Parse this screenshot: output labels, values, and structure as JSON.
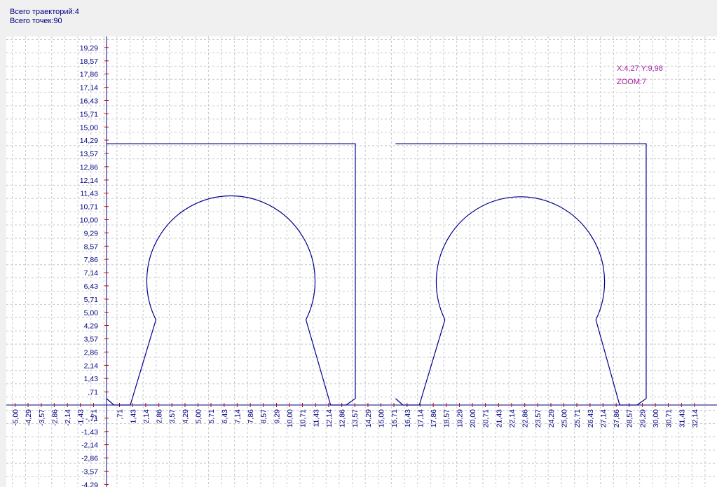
{
  "info": {
    "total_paths": "Всего траекторий:4",
    "total_points": "Всего точек:90"
  },
  "readout": {
    "coords": "X:4,27 Y:9,98",
    "zoom": "ZOOM:7"
  },
  "colors": {
    "background": "#ffffff",
    "grid": "#c8c8c8",
    "axis": "#000080",
    "path": "#00008b",
    "tick_text": "#000080",
    "readout_text": "#a020a0",
    "tick_marks": "#cc0000"
  },
  "chart_data": {
    "type": "line",
    "grid": true,
    "xlim": [
      -5.4,
      32.6
    ],
    "ylim": [
      -4.4,
      19.7
    ],
    "x_ticks": [
      "-5,00",
      "-4,29",
      "-3,57",
      "-2,86",
      "-2,14",
      "-1,43",
      "-,71",
      ",71",
      "1,43",
      "2,14",
      "2,86",
      "3,57",
      "4,29",
      "5,00",
      "5,71",
      "6,43",
      "7,14",
      "7,86",
      "8,57",
      "9,29",
      "10,00",
      "10,71",
      "11,43",
      "12,14",
      "12,86",
      "13,57",
      "14,29",
      "15,00",
      "15,71",
      "16,43",
      "17,14",
      "17,86",
      "18,57",
      "19,29",
      "20,00",
      "20,71",
      "21,43",
      "22,14",
      "22,86",
      "23,57",
      "24,29",
      "25,00",
      "25,71",
      "26,43",
      "27,14",
      "27,86",
      "28,57",
      "29,29",
      "30,00",
      "30,71",
      "31,43",
      "32,14"
    ],
    "y_ticks": [
      "19,29",
      "18,57",
      "17,86",
      "17,14",
      "16,43",
      "15,71",
      "15,00",
      "14,29",
      "13,57",
      "12,86",
      "12,14",
      "11,43",
      "10,71",
      "10,00",
      "9,29",
      "8,57",
      "7,86",
      "7,14",
      "6,43",
      "5,71",
      "5,00",
      "4,29",
      "3,57",
      "2,86",
      "2,14",
      "1,43",
      ",71",
      "-,71",
      "-1,43",
      "-2,14",
      "-2,86",
      "-3,57",
      "-4,29"
    ],
    "series": [
      {
        "points": [
          [
            0,
            14.1
          ],
          [
            13.6,
            14.1
          ],
          [
            13.6,
            0.35
          ],
          [
            13.1,
            0
          ],
          [
            12.25,
            0
          ],
          [
            10.9,
            4.6
          ]
        ]
      },
      {
        "points": [
          [
            15.8,
            14.1
          ],
          [
            29.5,
            14.1
          ],
          [
            29.5,
            0.35
          ],
          [
            29.0,
            0
          ],
          [
            28.05,
            0
          ],
          [
            26.75,
            4.6
          ]
        ]
      },
      {
        "points": [
          [
            2.7,
            4.6
          ],
          [
            1.3,
            0
          ],
          [
            0.4,
            0
          ],
          [
            0,
            0.35
          ]
        ]
      },
      {
        "points": [
          [
            18.5,
            4.6
          ],
          [
            17.1,
            0
          ],
          [
            16.2,
            0
          ],
          [
            15.8,
            0.35
          ]
        ]
      }
    ],
    "arcs": [
      {
        "start": [
          2.7,
          4.6
        ],
        "end": [
          10.9,
          4.6
        ],
        "center": [
          6.8,
          7.1
        ],
        "radius": 4.6
      },
      {
        "start": [
          18.5,
          4.6
        ],
        "end": [
          26.75,
          4.6
        ],
        "center": [
          22.62,
          7.1
        ],
        "radius": 4.6
      }
    ]
  }
}
